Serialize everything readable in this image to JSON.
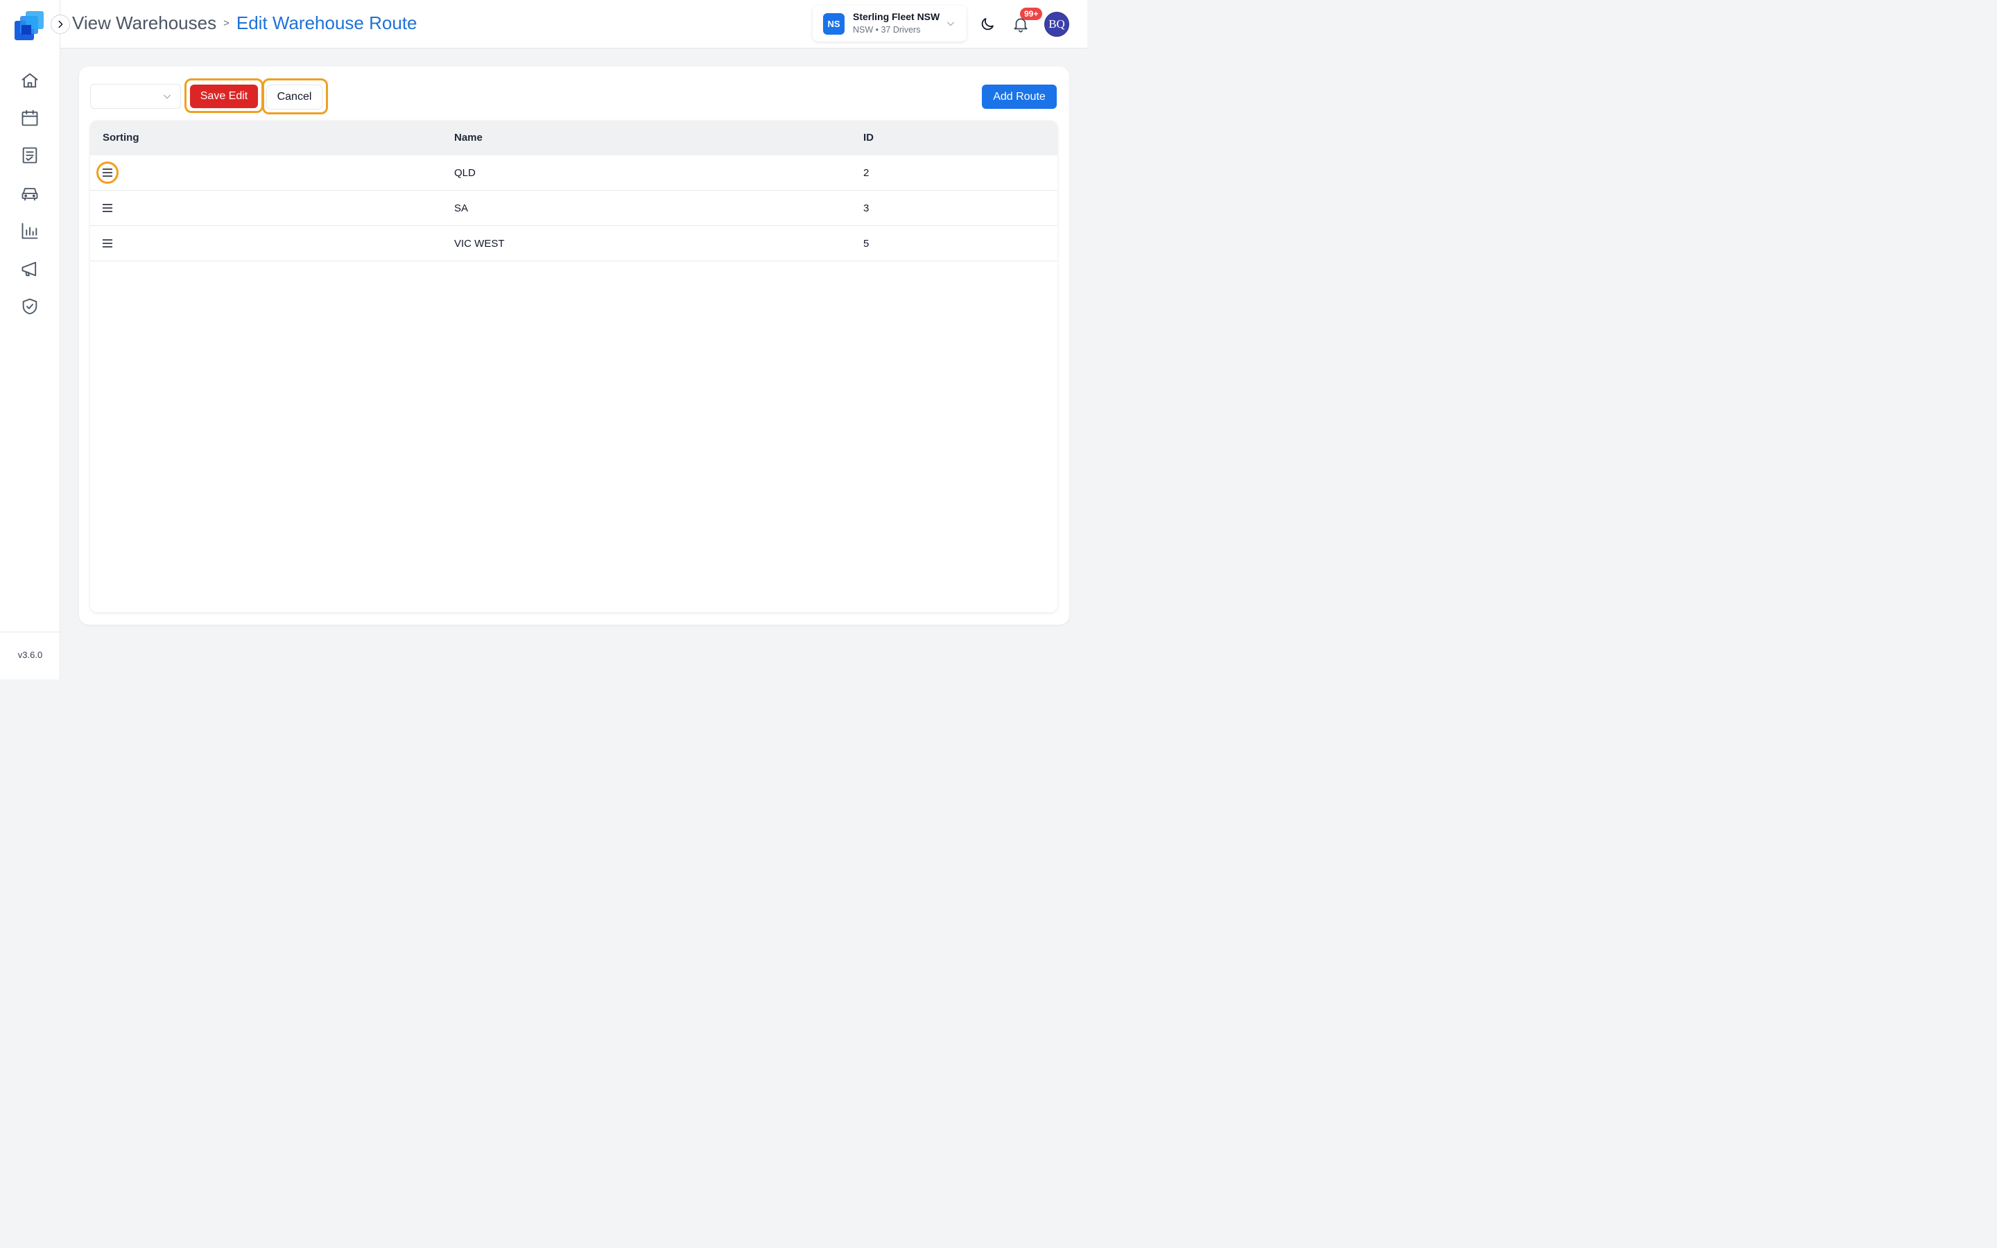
{
  "header": {
    "breadcrumb_parent": "View Warehouses",
    "breadcrumb_sep": ">",
    "breadcrumb_current": "Edit Warehouse Route",
    "org": {
      "initials": "NS",
      "name": "Sterling Fleet NSW",
      "subtitle": "NSW • 37 Drivers"
    },
    "notifications_badge": "99+",
    "user_initials": "BQ"
  },
  "sidebar": {
    "items": [
      {
        "icon": "home-icon"
      },
      {
        "icon": "calendar-icon"
      },
      {
        "icon": "document-icon"
      },
      {
        "icon": "car-icon"
      },
      {
        "icon": "bar-chart-icon"
      },
      {
        "icon": "megaphone-icon"
      },
      {
        "icon": "shield-check-icon"
      }
    ],
    "version": "v3.6.0"
  },
  "toolbar": {
    "save_label": "Save Edit",
    "cancel_label": "Cancel",
    "add_label": "Add Route"
  },
  "table": {
    "headers": [
      "Sorting",
      "Name",
      "ID"
    ],
    "rows": [
      {
        "name": "QLD",
        "id": "2"
      },
      {
        "name": "SA",
        "id": "3"
      },
      {
        "name": "VIC WEST",
        "id": "5"
      }
    ]
  },
  "colors": {
    "accent": "#1a73e8",
    "danger": "#dc2626",
    "highlight": "#f0a020"
  }
}
